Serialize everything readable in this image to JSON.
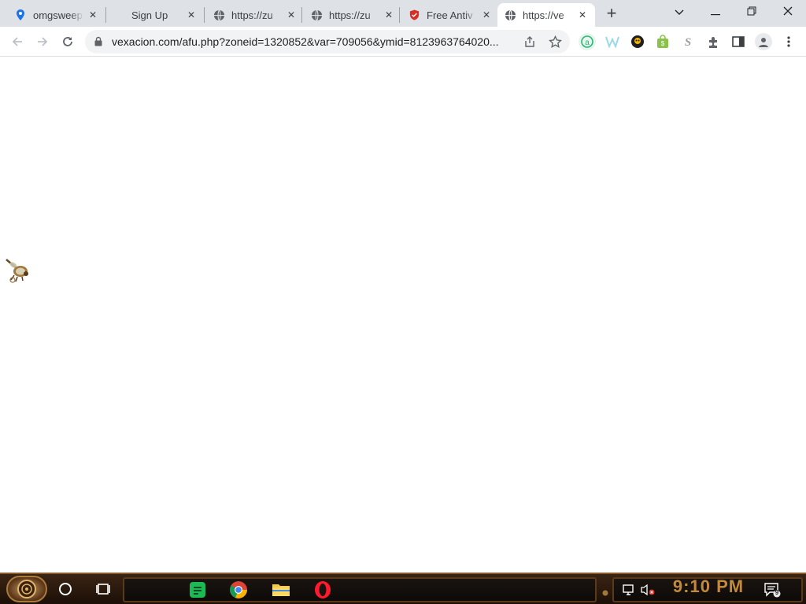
{
  "browser": {
    "tabs": [
      {
        "title": "omgsweeps",
        "favicon": "map-pin-icon",
        "active": false
      },
      {
        "title": "Sign Up",
        "favicon": "",
        "active": false
      },
      {
        "title": "https://zu",
        "favicon": "globe-icon",
        "active": false
      },
      {
        "title": "https://zu",
        "favicon": "globe-icon",
        "active": false
      },
      {
        "title": "Free Antiv",
        "favicon": "shield-icon",
        "active": false
      },
      {
        "title": "https://ve",
        "favicon": "globe-icon",
        "active": true
      }
    ],
    "address": {
      "url": "vexacion.com/afu.php?zoneid=1320852&var=709056&ymid=8123963764020..."
    },
    "colors": {
      "tabstrip_bg": "#dee1e6",
      "omnibox_bg": "#f1f3f4",
      "extension_green": "#2bb673"
    }
  },
  "taskbar": {
    "clock": "9:10 PM",
    "notification_count": "9",
    "pinned_apps": [
      "notes-app-icon",
      "chrome-icon",
      "file-explorer-icon",
      "opera-icon"
    ],
    "colors": {
      "clock": "#c48a3c",
      "frame": "#8a5a2a"
    }
  }
}
